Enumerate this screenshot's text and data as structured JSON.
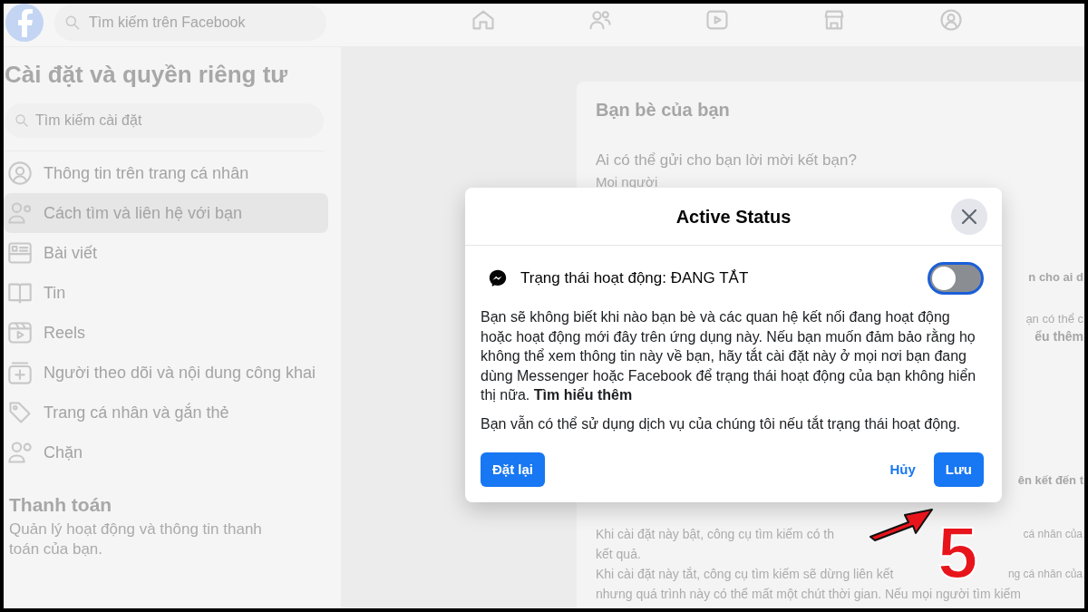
{
  "top_bar": {
    "search": {
      "placeholder": "Tìm kiếm trên Facebook"
    },
    "nav": [
      {
        "kind": "home"
      },
      {
        "kind": "friends"
      },
      {
        "kind": "video"
      },
      {
        "kind": "store"
      },
      {
        "kind": "groups"
      }
    ]
  },
  "sidebar": {
    "title": "Cài đặt và quyền riêng tư",
    "search": {
      "placeholder": "Tìm kiếm cài đặt"
    },
    "items": [
      {
        "kind": "profile",
        "label": "Thông tin trên trang cá nhân",
        "selected": false
      },
      {
        "kind": "people",
        "label": "Cách tìm và liên hệ với bạn",
        "selected": true
      },
      {
        "kind": "posts",
        "label": "Bài viết",
        "selected": false
      },
      {
        "kind": "book",
        "label": "Tin",
        "selected": false
      },
      {
        "kind": "reels",
        "label": "Reels",
        "selected": false
      },
      {
        "kind": "plus",
        "label": "Người theo dõi và nội dung công khai",
        "selected": false
      },
      {
        "kind": "tag",
        "label": "Trang cá nhân và gắn thẻ",
        "selected": false
      },
      {
        "kind": "block",
        "label": "Chặn",
        "selected": false
      }
    ],
    "section": {
      "title": "Thanh toán",
      "description": "Quản lý hoạt động và thông tin thanh toán của bạn."
    }
  },
  "card": {
    "title": "Bạn bè của bạn",
    "question": "Ai có thể gửi cho bạn lời mời kết bạn?",
    "answer": "Mọi người",
    "side_fragments": [
      {
        "kind": "heading",
        "text": "n cho ai d"
      },
      {
        "kind": "note",
        "text": "ạn có thể c"
      },
      {
        "kind": "link",
        "text": "ểu thêm"
      },
      {
        "kind": "heading",
        "text": "ên kết đến t"
      }
    ],
    "bottom_lines": [
      {
        "left": "Khi cài đặt này bật, công cụ tìm kiếm có th",
        "right": "cá nhân của"
      },
      {
        "left": "kết quả."
      },
      {
        "left": "Khi cài đặt này tắt, công cụ tìm kiếm sẽ dừng liên kết",
        "right": "ng cá nhân của"
      },
      {
        "left": "nhưng quá trình này có thể mất một chút thời gian. Nếu mọi người tìm kiếm"
      }
    ]
  },
  "dialog": {
    "title": "Active Status",
    "setting": {
      "label": "Trạng thái hoạt động: ĐANG TẮT",
      "on": false
    },
    "paragraphs": [
      {
        "text": "Bạn sẽ không biết khi nào bạn bè và các quan hệ kết nối đang hoạt động hoặc hoạt động mới đây trên ứng dụng này. Nếu bạn muốn đảm bảo rằng họ không thể xem thông tin này về bạn, hãy tắt cài đặt này ở mọi nơi bạn đang dùng Messenger hoặc Facebook để trạng thái hoạt động của bạn không hiển thị nữa.",
        "link": "Tìm hiểu thêm"
      },
      {
        "text": "Bạn vẫn có thể sử dụng dịch vụ của chúng tôi nếu tắt trạng thái hoạt động."
      }
    ],
    "buttons": [
      {
        "kind": "primary",
        "label": "Đặt lại"
      },
      {
        "kind": "spacer"
      },
      {
        "kind": "text",
        "label": "Hủy"
      },
      {
        "kind": "primary",
        "label": "Lưu"
      }
    ]
  },
  "annotation": {
    "label": "5"
  }
}
